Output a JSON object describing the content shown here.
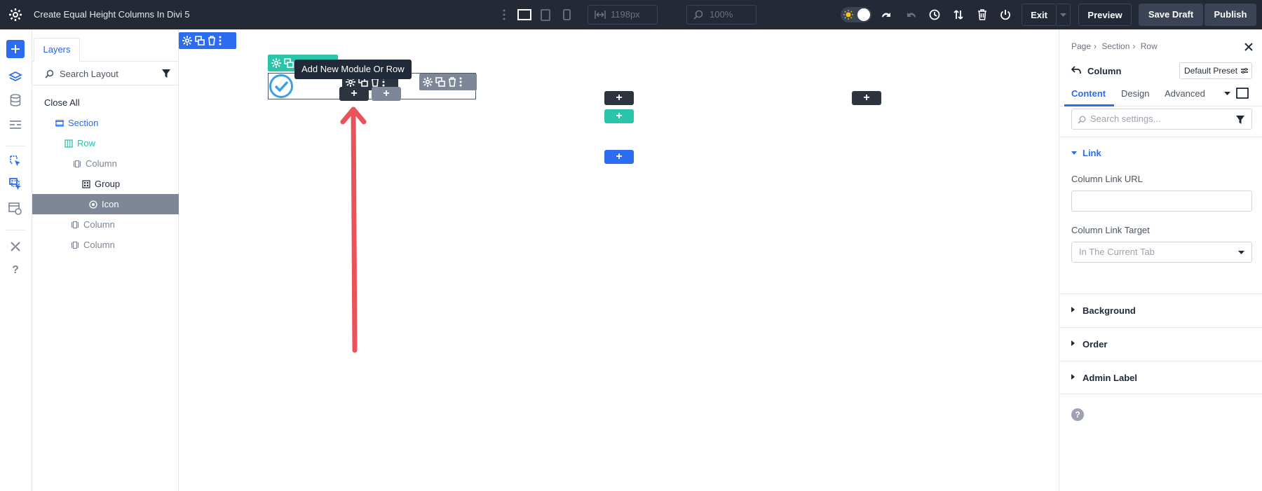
{
  "topbar": {
    "title": "Create Equal Height Columns In Divi 5",
    "width_value": "1198px",
    "zoom_value": "100%",
    "exit_label": "Exit",
    "preview_label": "Preview",
    "save_draft_label": "Save Draft",
    "publish_label": "Publish",
    "accent_color": "#2b87da"
  },
  "layers": {
    "tab_label": "Layers",
    "search_placeholder": "Search Layout",
    "close_all": "Close All",
    "items": [
      {
        "label": "Section",
        "icon": "section-icon"
      },
      {
        "label": "Row",
        "icon": "row-icon"
      },
      {
        "label": "Column",
        "icon": "column-icon"
      },
      {
        "label": "Group",
        "icon": "group-icon"
      },
      {
        "label": "Icon",
        "icon": "icon-module-icon"
      },
      {
        "label": "Column",
        "icon": "column-icon"
      },
      {
        "label": "Column",
        "icon": "column-icon"
      }
    ]
  },
  "canvas": {
    "tooltip": "Add New Module Or Row",
    "plus_symbol": "+"
  },
  "settings": {
    "breadcrumb": [
      "Page",
      "Section",
      "Row"
    ],
    "title": "Column",
    "preset_label": "Default Preset",
    "tabs": [
      "Content",
      "Design",
      "Advanced"
    ],
    "search_placeholder": "Search settings...",
    "link_section": "Link",
    "column_link_url_label": "Column Link URL",
    "column_link_url_value": "",
    "column_link_target_label": "Column Link Target",
    "column_link_target_value": "In The Current Tab",
    "sections": [
      "Background",
      "Order",
      "Admin Label"
    ]
  },
  "colors": {
    "topbar": "#232a36",
    "blue": "#2b6cf0",
    "teal": "#29c4a9",
    "gray_toolbar": "#7d8797",
    "dark_toolbar": "#2c3440",
    "selected_layer": "#7d8797",
    "arrow": "#e8545a"
  }
}
